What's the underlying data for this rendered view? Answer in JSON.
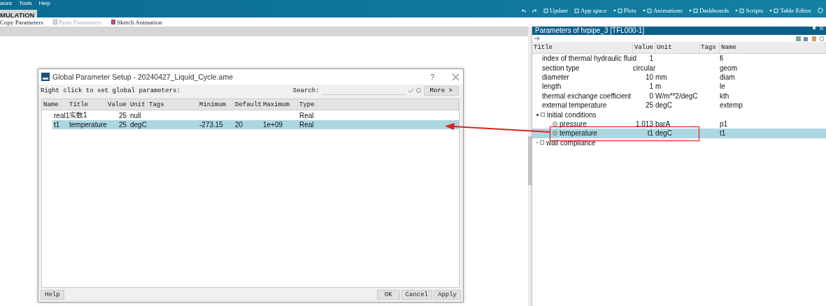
{
  "menu": [
    "aces",
    "Tools",
    "Help"
  ],
  "mode_tab": {
    "label": "MULATION",
    "selected": true
  },
  "top_toolbar": [
    {
      "label": "Update",
      "dropdown": false
    },
    {
      "label": "App space",
      "dropdown": false
    },
    {
      "label": "Plots",
      "dropdown": true
    },
    {
      "label": "Animations",
      "dropdown": true
    },
    {
      "label": "Dashboards",
      "dropdown": true
    },
    {
      "label": "Scripts",
      "dropdown": true
    },
    {
      "label": "Table Editor",
      "dropdown": true
    }
  ],
  "sub_toolbar": [
    {
      "label": "Copy Parameters",
      "disabled": false
    },
    {
      "label": "Paste Parameters",
      "disabled": true
    },
    {
      "label": "Sketch Animation",
      "disabled": false
    }
  ],
  "dialog": {
    "title": "Global Parameter Setup - 20240427_Liquid_Cycle.ame",
    "help_mark": "?",
    "hint": "Right click to set global parameters:",
    "search_label": "Search:",
    "more_button": "More >",
    "columns": [
      "Name",
      "Title",
      "Value",
      "Unit",
      "Tags",
      "Minimum",
      "Default",
      "Maximum",
      "Type"
    ],
    "rows": [
      {
        "selected": false,
        "cells": [
          "real1",
          "实数1",
          "25",
          "null",
          "",
          "",
          "",
          "",
          "Real"
        ]
      },
      {
        "selected": true,
        "cells": [
          "t1",
          "temperature",
          "25",
          "degC",
          "",
          "-273.15",
          "20",
          "1e+09",
          "Real"
        ]
      }
    ],
    "buttons": [
      "Help",
      "OK",
      "Cancel",
      "Apply"
    ]
  },
  "panel": {
    "title": "Parameters of hrpipe_3 [TFL000-1]",
    "columns": [
      "Title",
      "Value",
      "Unit",
      "Tags",
      "Name"
    ],
    "rows": [
      {
        "kind": "param",
        "selected": false,
        "title": "index of thermal hydraulic fluid",
        "value": "1",
        "unit": "",
        "name": "fi"
      },
      {
        "kind": "param",
        "selected": false,
        "title": "section type",
        "value": "circular",
        "unit": "",
        "name": "geom"
      },
      {
        "kind": "param",
        "selected": false,
        "title": "diameter",
        "value": "10",
        "unit": "mm",
        "name": "diam"
      },
      {
        "kind": "param",
        "selected": false,
        "title": "length",
        "value": "1",
        "unit": "m",
        "name": "le"
      },
      {
        "kind": "param",
        "selected": false,
        "title": "thermal exchange coefficient",
        "value": "0",
        "unit": "W/m**2/degC",
        "name": "kth"
      },
      {
        "kind": "param",
        "selected": false,
        "title": "external temperature",
        "value": "25",
        "unit": "degC",
        "name": "extemp"
      },
      {
        "kind": "group",
        "expanded": true,
        "title": "initial conditions",
        "children": [
          {
            "kind": "param",
            "selected": false,
            "title": "pressure",
            "value": "1.013",
            "unit": "barA",
            "name": "p1"
          },
          {
            "kind": "param",
            "selected": true,
            "title": "temperature",
            "value": "t1",
            "unit": "degC",
            "name": "t1"
          }
        ]
      },
      {
        "kind": "group",
        "expanded": false,
        "title": "wall compliance",
        "children": []
      }
    ]
  }
}
